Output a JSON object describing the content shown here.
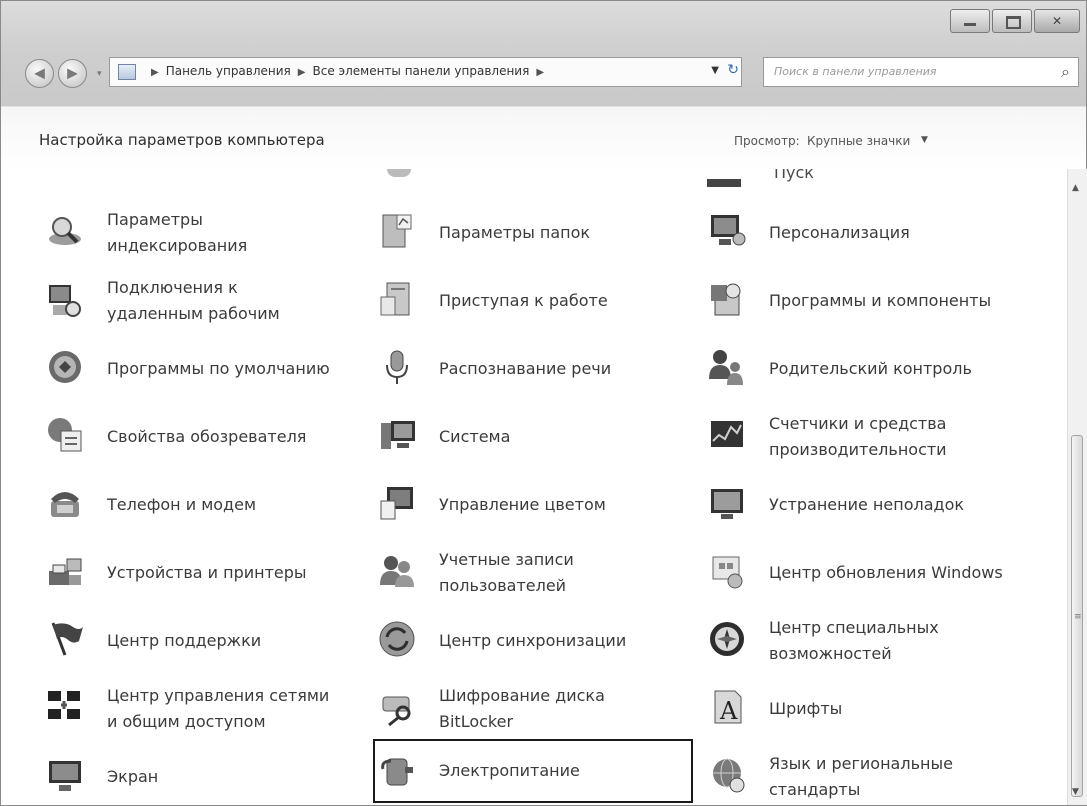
{
  "window": {
    "caption_buttons": [
      "minimize-icon",
      "maximize-icon",
      "close-icon"
    ]
  },
  "nav": {
    "back_icon": "back-arrow-icon",
    "forward_icon": "forward-arrow-icon",
    "breadcrumbs": [
      "Панель управления",
      "Все элементы панели управления"
    ],
    "search_placeholder": "Поиск в панели управления"
  },
  "header": {
    "title": "Настройка параметров компьютера",
    "view_label": "Просмотр:",
    "view_value": "Крупные значки"
  },
  "partial_row": {
    "col3_text": "Пуск"
  },
  "items": [
    {
      "label": "Параметры индексирования",
      "icon": "search-index-icon"
    },
    {
      "label": "Параметры папок",
      "icon": "folder-options-icon"
    },
    {
      "label": "Персонализация",
      "icon": "personalization-icon"
    },
    {
      "label": "Подключения к удаленным рабочим",
      "icon": "remote-connections-icon"
    },
    {
      "label": "Приступая к работе",
      "icon": "getting-started-icon"
    },
    {
      "label": "Программы и компоненты",
      "icon": "programs-features-icon"
    },
    {
      "label": "Программы по умолчанию",
      "icon": "default-programs-icon"
    },
    {
      "label": "Распознавание речи",
      "icon": "microphone-icon"
    },
    {
      "label": "Родительский контроль",
      "icon": "parental-control-icon"
    },
    {
      "label": "Свойства обозревателя",
      "icon": "internet-options-icon"
    },
    {
      "label": "Система",
      "icon": "system-icon"
    },
    {
      "label": "Счетчики и средства производительности",
      "icon": "performance-icon"
    },
    {
      "label": "Телефон и модем",
      "icon": "phone-modem-icon"
    },
    {
      "label": "Управление цветом",
      "icon": "color-management-icon"
    },
    {
      "label": "Устранение неполадок",
      "icon": "troubleshooting-icon"
    },
    {
      "label": "Устройства и принтеры",
      "icon": "devices-printers-icon"
    },
    {
      "label": "Учетные записи пользователей",
      "icon": "user-accounts-icon"
    },
    {
      "label": "Центр обновления Windows",
      "icon": "windows-update-icon"
    },
    {
      "label": "Центр поддержки",
      "icon": "action-center-flag-icon"
    },
    {
      "label": "Центр синхронизации",
      "icon": "sync-center-icon"
    },
    {
      "label": "Центр специальных возможностей",
      "icon": "ease-of-access-icon"
    },
    {
      "label": "Центр управления сетями и общим доступом",
      "icon": "network-center-icon"
    },
    {
      "label": "Шифрование диска BitLocker",
      "icon": "bitlocker-key-icon"
    },
    {
      "label": "Шрифты",
      "icon": "fonts-icon"
    },
    {
      "label": "Экран",
      "icon": "display-icon"
    },
    {
      "label": "Электропитание",
      "icon": "power-options-icon",
      "selected": true
    },
    {
      "label": "Язык и региональные стандарты",
      "icon": "region-language-icon"
    }
  ],
  "scrollbar": {
    "up_icon": "scroll-up-icon",
    "down_icon": "scroll-down-icon"
  }
}
